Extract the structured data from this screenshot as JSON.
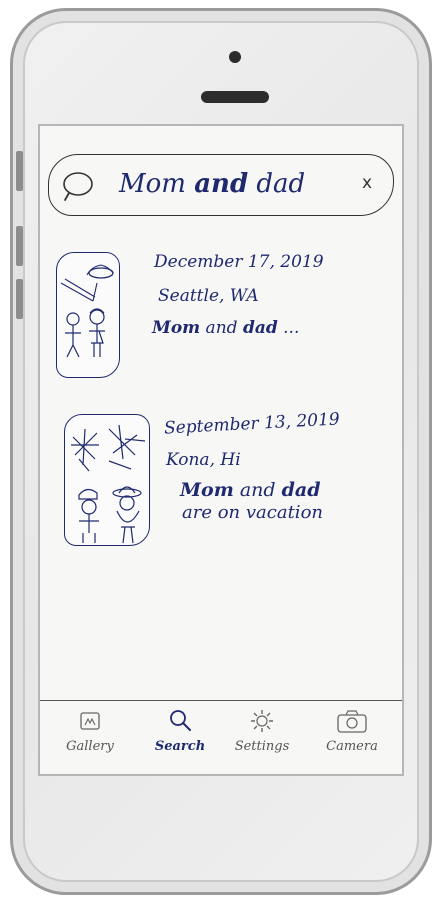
{
  "search": {
    "query_prefix": "Mom ",
    "query_highlight": "and",
    "query_suffix": " dad",
    "clear_label": "x"
  },
  "results": [
    {
      "date": "December 17, 2019",
      "place": "Seattle, WA",
      "caption_hl1": "Mom",
      "caption_mid": " and ",
      "caption_hl2": "dad",
      "caption_end": " ...",
      "caption_line2": ""
    },
    {
      "date": "September 13, 2019",
      "place": "Kona, Hi",
      "caption_hl1": "Mom",
      "caption_mid": " and ",
      "caption_hl2": "dad",
      "caption_end": "",
      "caption_line2": "are on vacation"
    }
  ],
  "tabs": [
    {
      "label": "Gallery",
      "icon": "gallery-icon"
    },
    {
      "label": "Search",
      "icon": "search-icon",
      "active": true
    },
    {
      "label": "Settings",
      "icon": "gear-icon"
    },
    {
      "label": "Camera",
      "icon": "camera-icon"
    }
  ],
  "colors": {
    "ink": "#1f2a6e",
    "screen_bg": "#f7f7f6",
    "frame": "#9b9b9b"
  }
}
